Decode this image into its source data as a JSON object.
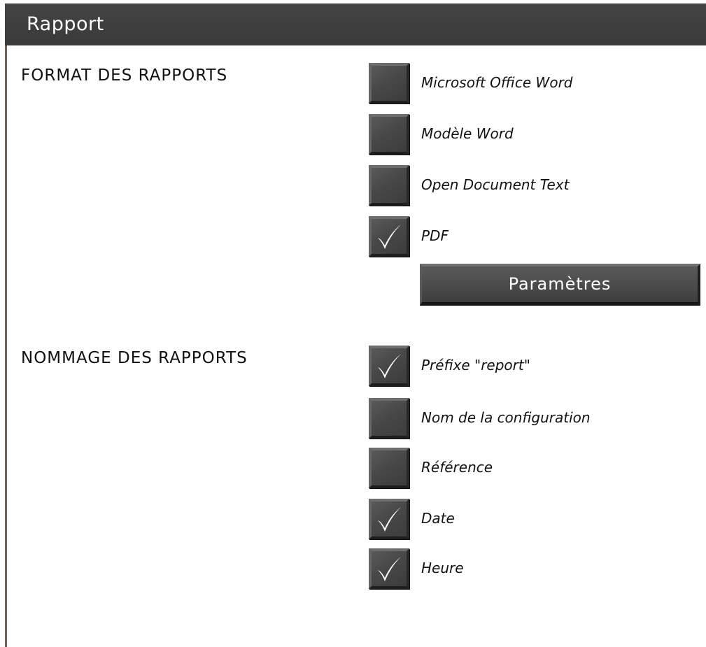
{
  "panel": {
    "title": "Rapport"
  },
  "format_section": {
    "label": "FORMAT DES RAPPORTS",
    "options": [
      {
        "label": "Microsoft Office Word",
        "checked": false
      },
      {
        "label": "Modèle Word",
        "checked": false
      },
      {
        "label": "Open Document Text",
        "checked": false
      },
      {
        "label": "PDF",
        "checked": true
      }
    ],
    "settings_button": "Paramètres"
  },
  "naming_section": {
    "label": "NOMMAGE DES RAPPORTS",
    "options": [
      {
        "label": "Préfixe \"report\"",
        "checked": true
      },
      {
        "label": "Nom de la configuration",
        "checked": false
      },
      {
        "label": "Référence",
        "checked": false
      },
      {
        "label": "Date",
        "checked": true
      },
      {
        "label": "Heure",
        "checked": true
      }
    ]
  },
  "colors": {
    "header_bg": "#3f3f3f",
    "checkbox_bg": "#4a4a4a",
    "check_mark": "#ffffff",
    "text": "#111111"
  },
  "icons": {
    "checked": "checkmark-icon"
  }
}
